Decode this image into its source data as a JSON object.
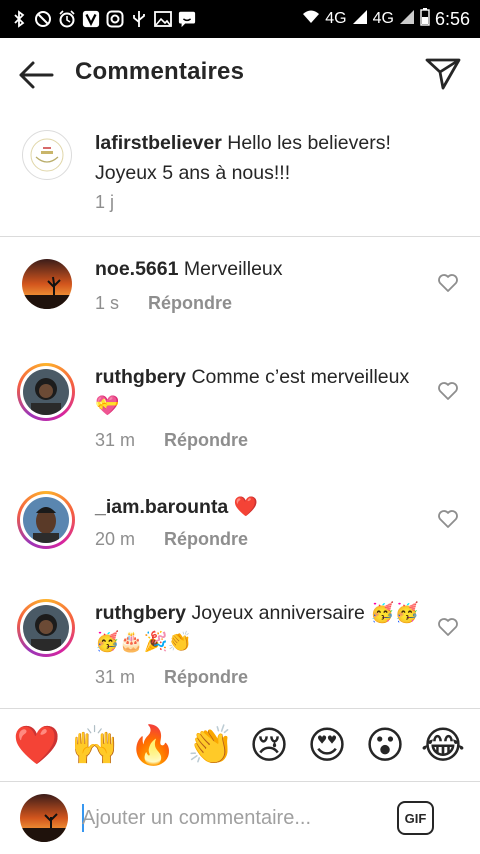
{
  "status_bar": {
    "network_1": "4G",
    "network_2": "4G",
    "time": "6:56",
    "left_icons": [
      "bluetooth-icon",
      "do-not-disturb-icon",
      "alarm-icon",
      "viber-icon",
      "instagram-icon",
      "usb-icon",
      "image-icon",
      "chat-icon"
    ]
  },
  "header": {
    "title": "Commentaires"
  },
  "caption": {
    "username": "lafirstbeliever",
    "text": "Hello les believers! Joyeux 5 ans à nous!!!",
    "time": "1 j"
  },
  "comments": [
    {
      "username": "noe.5661",
      "text": "Merveilleux",
      "time": "1 s",
      "reply_label": "Répondre"
    },
    {
      "username": "ruthgbery",
      "text": "Comme c’est merveilleux 💝",
      "time": "31 m",
      "reply_label": "Répondre"
    },
    {
      "username": "_iam.barounta",
      "text": "❤️",
      "time": "20 m",
      "reply_label": "Répondre"
    },
    {
      "username": "ruthgbery",
      "text": "Joyeux anniversaire 🥳🥳🥳🎂🎉👏",
      "time": "31 m",
      "reply_label": "Répondre"
    }
  ],
  "reactions": [
    "❤️",
    "🙌",
    "🔥",
    "👏",
    "😢",
    "😍",
    "😮",
    "😂"
  ],
  "input": {
    "placeholder": "Ajouter un commentaire...",
    "gif_label": "GIF"
  },
  "colors": {
    "text": "#262626",
    "secondary": "#8e8e8e",
    "divider": "#dbdbdb",
    "story_ring": "#d6249f"
  }
}
